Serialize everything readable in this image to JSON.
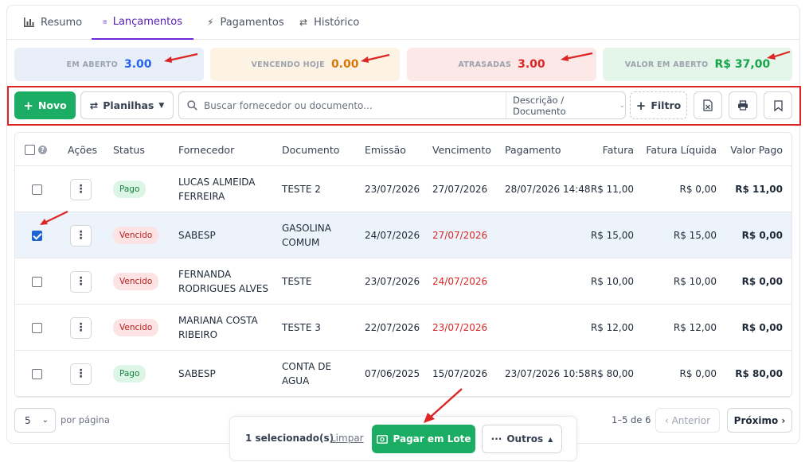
{
  "tabs": [
    {
      "label": "Resumo",
      "icon": "bar-chart-icon",
      "active": false
    },
    {
      "label": "Lançamentos",
      "icon": "list-icon",
      "active": true
    },
    {
      "label": "Pagamentos",
      "icon": "lightning-icon",
      "active": false
    },
    {
      "label": "Histórico",
      "icon": "swap-icon",
      "active": false
    }
  ],
  "stats": [
    {
      "label": "EM ABERTO",
      "value": "3.00",
      "color": "#2563eb",
      "bg": "#e8eff9"
    },
    {
      "label": "VENCENDO HOJE",
      "value": "0.00",
      "color": "#d97706",
      "bg": "#fdf3e4"
    },
    {
      "label": "ATRASADAS",
      "value": "3.00",
      "color": "#dc2626",
      "bg": "#fde8e8"
    },
    {
      "label": "VALOR EM ABERTO",
      "value": "R$ 37,00",
      "color": "#16a34a",
      "bg": "#e4f5ea"
    }
  ],
  "toolbar": {
    "new_label": "Novo",
    "sheets_label": "Planilhas",
    "search_placeholder": "Buscar fornecedor ou documento...",
    "search_scope": "Descrição / Documento",
    "filter_label": "Filtro"
  },
  "table": {
    "headers": [
      "Ações",
      "Status",
      "Fornecedor",
      "Documento",
      "Emissão",
      "Vencimento",
      "Pagamento",
      "Fatura",
      "Fatura Líquida",
      "Valor Pago"
    ],
    "rows": [
      {
        "selected": false,
        "status": "Pago",
        "supplier_1": "LUCAS ALMEIDA",
        "supplier_2": "FERREIRA",
        "document_1": "TESTE 2",
        "document_2": "",
        "issued": "23/07/2026",
        "due": "27/07/2026",
        "due_overdue": false,
        "paid_at": "28/07/2026 14:48",
        "invoice": "R$ 11,00",
        "net": "R$ 0,00",
        "paid": "R$ 11,00"
      },
      {
        "selected": true,
        "status": "Vencido",
        "supplier_1": "SABESP",
        "supplier_2": "",
        "document_1": "GASOLINA",
        "document_2": "COMUM",
        "issued": "24/07/2026",
        "due": "27/07/2026",
        "due_overdue": true,
        "paid_at": "",
        "invoice": "R$ 15,00",
        "net": "R$ 15,00",
        "paid": "R$ 0,00"
      },
      {
        "selected": false,
        "status": "Vencido",
        "supplier_1": "FERNANDA",
        "supplier_2": "RODRIGUES ALVES",
        "document_1": "TESTE",
        "document_2": "",
        "issued": "23/07/2026",
        "due": "24/07/2026",
        "due_overdue": true,
        "paid_at": "",
        "invoice": "R$ 10,00",
        "net": "R$ 10,00",
        "paid": "R$ 0,00"
      },
      {
        "selected": false,
        "status": "Vencido",
        "supplier_1": "MARIANA COSTA",
        "supplier_2": "RIBEIRO",
        "document_1": "TESTE 3",
        "document_2": "",
        "issued": "22/07/2026",
        "due": "23/07/2026",
        "due_overdue": true,
        "paid_at": "",
        "invoice": "R$ 12,00",
        "net": "R$ 12,00",
        "paid": "R$ 0,00"
      },
      {
        "selected": false,
        "status": "Pago",
        "supplier_1": "SABESP",
        "supplier_2": "",
        "document_1": "CONTA DE",
        "document_2": "AGUA",
        "issued": "07/06/2025",
        "due": "15/07/2026",
        "due_overdue": false,
        "paid_at": "23/07/2026 10:58",
        "invoice": "R$ 80,00",
        "net": "R$ 0,00",
        "paid": "R$ 80,00"
      }
    ]
  },
  "footer": {
    "per_page_value": "5",
    "per_page_label": "por página",
    "range": "1–5 de 6",
    "prev_label": "‹ Anterior",
    "next_label": "Próximo ›"
  },
  "bulk": {
    "selected_text": "1 selecionado(s)",
    "clear_label": "Limpar",
    "pay_label": "Pagar em Lote",
    "others_label": "Outros"
  },
  "colors": {
    "accent": "#6d28d9",
    "primary_green": "#1bad63",
    "annotation_red": "#dc2626"
  }
}
